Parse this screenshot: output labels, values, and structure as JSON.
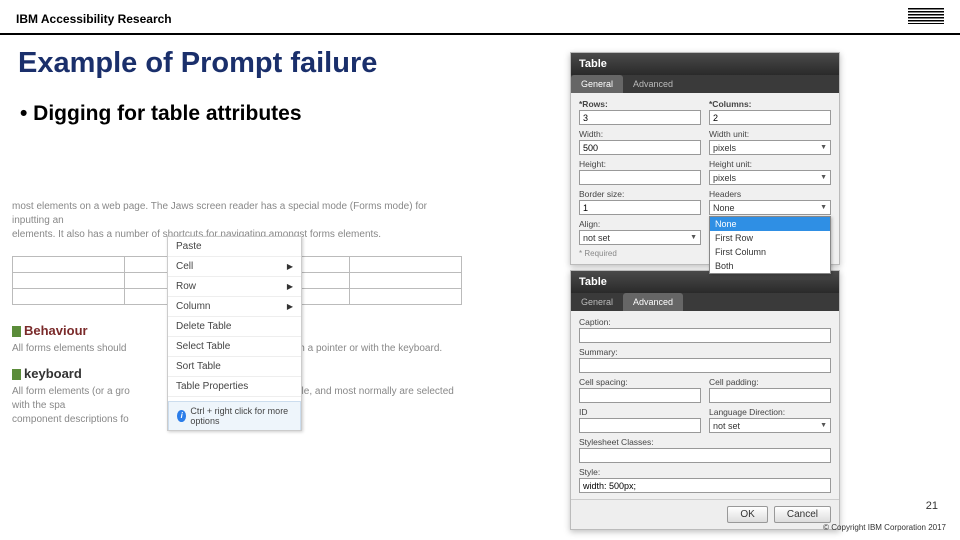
{
  "header": {
    "brand": "IBM Accessibility Research"
  },
  "title": "Example of Prompt failure",
  "bullet": "• Digging for table attributes",
  "left": {
    "body1": "most elements on a web page. The Jaws screen reader has a special mode (Forms mode) for inputting an",
    "body2": "elements. It also has a number of shortcuts for navigating amongst forms elements.",
    "menu": {
      "paste": "Paste",
      "cell": "Cell",
      "row": "Row",
      "column": "Column",
      "delete": "Delete Table",
      "select": "Select Table",
      "sort": "Sort Table",
      "props": "Table Properties"
    },
    "info": "Ctrl + right click for more options",
    "behaviour": "Behaviour",
    "behaviour_txt": "All forms elements should",
    "behaviour_tail": "either with a pointer or with the keyboard.",
    "keyboard": "keyboard",
    "keyboard_txt": "All form elements (or a gro",
    "keyboard_tail": "a tabbable, and most normally are selected with the spa",
    "keyboard_txt2": "component descriptions fo"
  },
  "dlg1": {
    "title": "Table",
    "tabs": {
      "general": "General",
      "advanced": "Advanced"
    },
    "rows_lbl": "*Rows:",
    "rows_val": "3",
    "cols_lbl": "*Columns:",
    "cols_val": "2",
    "width_lbl": "Width:",
    "width_val": "500",
    "wunit_lbl": "Width unit:",
    "wunit_val": "pixels",
    "height_lbl": "Height:",
    "height_val": "",
    "hunit_lbl": "Height unit:",
    "hunit_val": "pixels",
    "border_lbl": "Border size:",
    "border_val": "1",
    "headers_lbl": "Headers",
    "headers_val": "None",
    "align_lbl": "Align:",
    "align_val": "not set",
    "drop_none": "None",
    "drop_first_row": "First Row",
    "drop_first_col": "First Column",
    "drop_both": "Both",
    "required": "* Required"
  },
  "dlg2": {
    "title": "Table",
    "tabs": {
      "general": "General",
      "advanced": "Advanced"
    },
    "caption_lbl": "Caption:",
    "summary_lbl": "Summary:",
    "cspace_lbl": "Cell spacing:",
    "cpad_lbl": "Cell padding:",
    "id_lbl": "ID",
    "langdir_lbl": "Language Direction:",
    "langdir_val": "not set",
    "styleclass_lbl": "Stylesheet Classes:",
    "style_lbl": "Style:",
    "style_val": "width: 500px;",
    "ok": "OK",
    "cancel": "Cancel"
  },
  "pagenum": "21",
  "copyright": "© Copyright IBM Corporation 2017"
}
